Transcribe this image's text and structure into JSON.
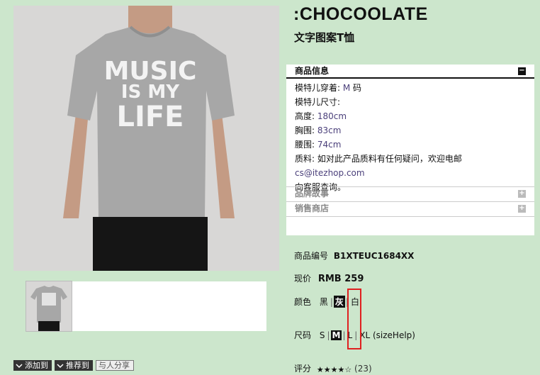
{
  "product": {
    "brand": ":CHOCOOLATE",
    "subtitle": "文字图案T恤",
    "shirt_print": [
      "MUSIC",
      "IS MY",
      "LIFE"
    ]
  },
  "info": {
    "header": "商品信息",
    "lines": [
      {
        "label": "模特儿穿着:",
        "value": " M",
        "suffix": " 码"
      },
      {
        "label": "模特儿尺寸:",
        "value": "",
        "suffix": ""
      },
      {
        "label": "高度:",
        "value": " 180cm",
        "suffix": ""
      },
      {
        "label": "胸围:",
        "value": " 83cm",
        "suffix": ""
      },
      {
        "label": "腰围:",
        "value": " 74cm",
        "suffix": ""
      }
    ],
    "material_label": "质料:",
    "material_text": " 如对此产品质料有任何疑问，欢迎电邮",
    "material_email": "cs@itezhop.com",
    "material_tail": "向客服查询。",
    "sections": [
      "品牌故事",
      "销售商店"
    ]
  },
  "details": {
    "sku_label": "商品编号",
    "sku": "B1XTEUC1684XX",
    "price_label": "现价",
    "price": "RMB 259",
    "color_label": "颜色",
    "colors": [
      "黑",
      "灰",
      "白"
    ],
    "selected_color": "灰",
    "size_label": "尺码",
    "sizes": [
      "S",
      "M",
      "L",
      "XL (sizeHelp)"
    ],
    "selected_size": "M",
    "rating_label": "评分",
    "rating": 4,
    "rating_max": 5,
    "rating_count": "(23)"
  },
  "actions": {
    "add": "添加到",
    "recommend": "推荐到",
    "share": "与人分享"
  },
  "colors": {
    "background": "#cce6cc",
    "highlight": "#e02020",
    "value_text": "#4a3f7a"
  }
}
